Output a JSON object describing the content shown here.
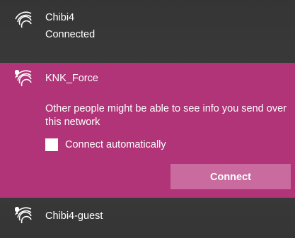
{
  "networks": [
    {
      "name": "Chibi4",
      "status": "Connected",
      "secured": false
    },
    {
      "name": "KNK_Force",
      "secured": false,
      "warning": "Other people might be able to see info you send over this network",
      "auto_connect_label": "Connect automatically",
      "auto_connect_checked": false,
      "connect_button_label": "Connect"
    },
    {
      "name": "Chibi4-guest",
      "secured": false
    }
  ],
  "colors": {
    "panel_background": "#353535",
    "selected_background": "#b03477",
    "connect_button": "#c96b9e",
    "text": "#ffffff"
  },
  "icons": {
    "wifi": "wifi-signal-icon",
    "open_network": "wifi-unsecured-icon",
    "checkbox": "checkbox-unchecked-icon"
  }
}
